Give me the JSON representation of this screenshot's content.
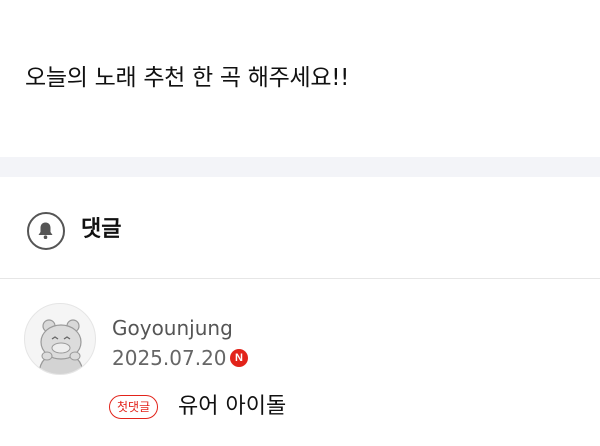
{
  "post": {
    "text": "오늘의 노래 추천 한 곡 해주세요!!"
  },
  "comments_section": {
    "title": "댓글",
    "bell_icon": "bell-icon"
  },
  "comments": [
    {
      "author": "Goyounjung",
      "date": "2025.07.20",
      "platform_badge": "N",
      "first_comment_badge": "첫댓글",
      "text": "유어 아이돌"
    }
  ],
  "colors": {
    "accent_red": "#e2231a",
    "section_gap": "#f3f4f8",
    "divider": "#e6e6e6"
  }
}
